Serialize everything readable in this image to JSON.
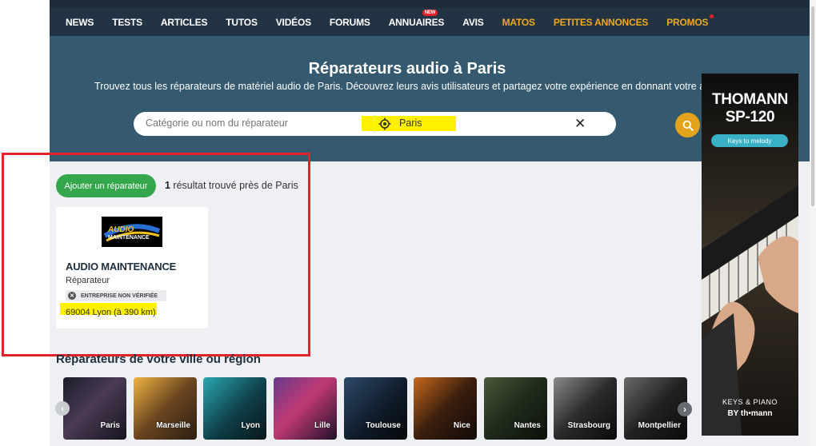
{
  "nav": {
    "items": [
      {
        "label": "NEWS"
      },
      {
        "label": "TESTS"
      },
      {
        "label": "ARTICLES"
      },
      {
        "label": "TUTOS"
      },
      {
        "label": "VIDÉOS"
      },
      {
        "label": "FORUMS"
      },
      {
        "label": "ANNUAIRES"
      },
      {
        "label": "AVIS"
      },
      {
        "label": "MATOS"
      },
      {
        "label": "PETITES ANNONCES"
      },
      {
        "label": "PROMOS"
      }
    ],
    "badge_new": "NEW",
    "accent_color": "#f0a81e"
  },
  "hero": {
    "title": "Réparateurs audio à Paris",
    "subtitle": "Trouvez tous les réparateurs de matériel audio de Paris. Découvrez leurs avis utilisateurs et partagez votre expérience en donnant votre avis."
  },
  "search": {
    "placeholder": "Catégorie ou nom du réparateur",
    "location_value": "Paris",
    "clear_icon": "close-icon",
    "search_icon": "search-icon"
  },
  "results": {
    "add_label": "Ajouter un réparateur",
    "count": "1",
    "count_text": " résultat trouvé près de Paris"
  },
  "card": {
    "logo_text_1": "AUDIO",
    "logo_text_2": "MAINTENANCE",
    "name": "AUDIO MAINTENANCE",
    "type": "Réparateur",
    "badge": "ENTREPRISE NON VÉRIFIÉE",
    "address": "69004 Lyon (à 390 km)"
  },
  "cities": {
    "title": "Réparateurs de votre ville ou région",
    "items": [
      {
        "name": "Paris"
      },
      {
        "name": "Marseille"
      },
      {
        "name": "Lyon"
      },
      {
        "name": "Lille"
      },
      {
        "name": "Toulouse"
      },
      {
        "name": "Nice"
      },
      {
        "name": "Nantes"
      },
      {
        "name": "Strasbourg"
      },
      {
        "name": "Montpellier"
      }
    ]
  },
  "ad": {
    "brand_line1": "THOMANN",
    "brand_line2": "SP-120",
    "button": "Keys to melody",
    "footer1": "KEYS & PIANO",
    "footer2": "BY th•mann"
  },
  "colors": {
    "nav_bg": "#223344",
    "hero_bg": "#35596e",
    "add_button": "#34a64b",
    "search_button": "#e3a31c",
    "highlight": "#fff100",
    "annotation_red": "#e1232b"
  }
}
